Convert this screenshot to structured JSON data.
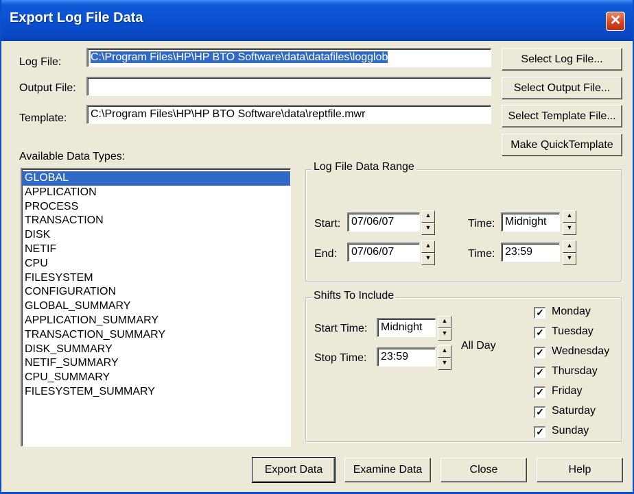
{
  "window": {
    "title": "Export Log File Data",
    "close_glyph": "✕"
  },
  "fields": {
    "log_file": {
      "label": "Log File:",
      "value": "C:\\Program Files\\HP\\HP BTO Software\\data\\datafiles\\logglob"
    },
    "output_file": {
      "label": "Output File:",
      "value": ""
    },
    "template": {
      "label": "Template:",
      "value": "C:\\Program Files\\HP\\HP BTO Software\\data\\reptfile.mwr"
    }
  },
  "side_buttons": {
    "select_log": "Select Log File...",
    "select_output": "Select Output File...",
    "select_template": "Select Template File...",
    "make_quick": "Make QuickTemplate"
  },
  "data_types": {
    "label": "Available Data Types:",
    "selected": "GLOBAL",
    "items": [
      "GLOBAL",
      "APPLICATION",
      "PROCESS",
      "TRANSACTION",
      "DISK",
      "NETIF",
      "CPU",
      "FILESYSTEM",
      "CONFIGURATION",
      "GLOBAL_SUMMARY",
      "APPLICATION_SUMMARY",
      "TRANSACTION_SUMMARY",
      "DISK_SUMMARY",
      "NETIF_SUMMARY",
      "CPU_SUMMARY",
      "FILESYSTEM_SUMMARY"
    ]
  },
  "range": {
    "title": "Log File Data Range",
    "start_label": "Start:",
    "start_date": "07/06/07",
    "start_time_label": "Time:",
    "start_time": "Midnight",
    "end_label": "End:",
    "end_date": "07/06/07",
    "end_time_label": "Time:",
    "end_time": "23:59"
  },
  "shifts": {
    "title": "Shifts To Include",
    "start_label": "Start Time:",
    "start_value": "Midnight",
    "stop_label": "Stop Time:",
    "stop_value": "23:59",
    "all_day": "All Day",
    "days": [
      {
        "label": "Monday",
        "checked": true
      },
      {
        "label": "Tuesday",
        "checked": true
      },
      {
        "label": "Wednesday",
        "checked": true
      },
      {
        "label": "Thursday",
        "checked": true
      },
      {
        "label": "Friday",
        "checked": true
      },
      {
        "label": "Saturday",
        "checked": true
      },
      {
        "label": "Sunday",
        "checked": true
      }
    ]
  },
  "bottom_buttons": {
    "export": "Export Data",
    "examine": "Examine Data",
    "close": "Close",
    "help": "Help"
  },
  "glyphs": {
    "spin_up": "▲",
    "spin_down": "▼",
    "check": "✓"
  }
}
